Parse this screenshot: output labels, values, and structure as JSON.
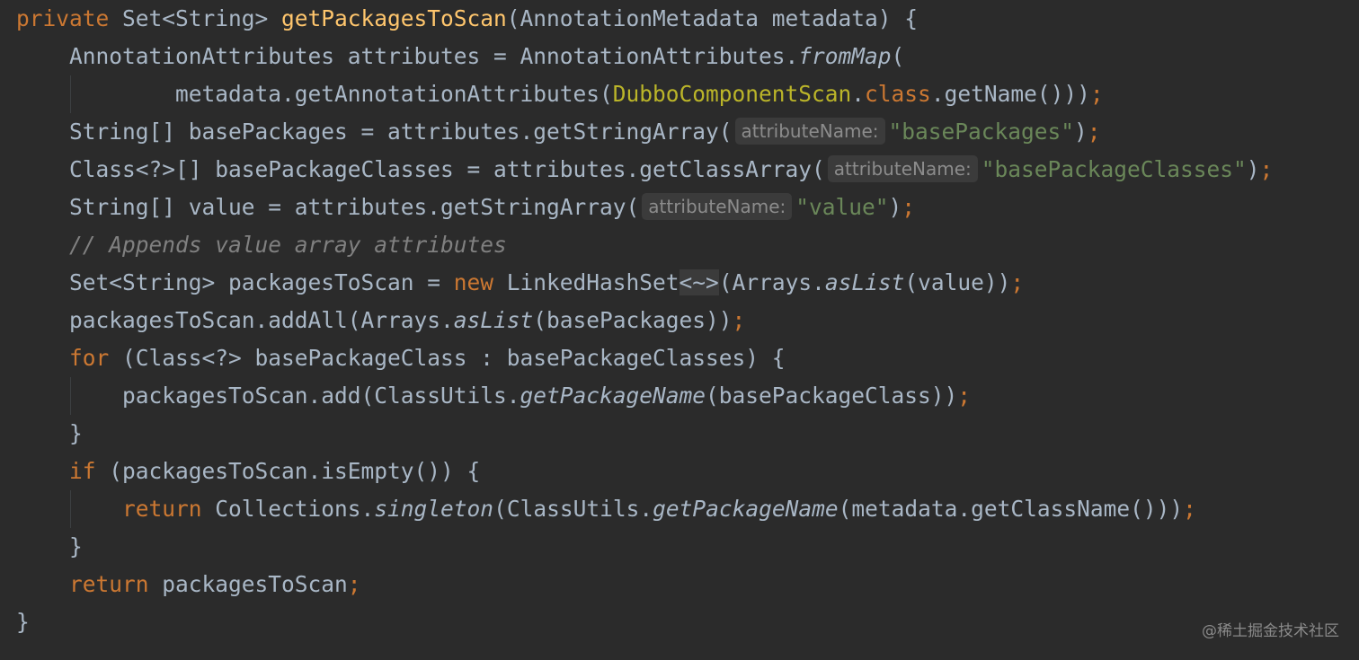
{
  "lines": [
    [
      {
        "t": "private ",
        "c": "kw"
      },
      {
        "t": "Set<String> ",
        "c": ""
      },
      {
        "t": "getPackagesToScan",
        "c": "fn"
      },
      {
        "t": "(AnnotationMetadata metadata) {",
        "c": ""
      }
    ],
    [
      {
        "t": "    AnnotationAttributes attributes = AnnotationAttributes.",
        "c": ""
      },
      {
        "t": "fromMap",
        "c": "ital"
      },
      {
        "t": "(",
        "c": ""
      }
    ],
    [
      {
        "t": "            metadata.getAnnotationAttributes(",
        "c": ""
      },
      {
        "t": "DubboComponentScan",
        "c": "ann"
      },
      {
        "t": ".",
        "c": ""
      },
      {
        "t": "class",
        "c": "kw"
      },
      {
        "t": ".getName()))",
        "c": ""
      },
      {
        "t": ";",
        "c": "punc"
      }
    ],
    [
      {
        "t": "    String[] basePackages = attributes.getStringArray(",
        "c": ""
      },
      {
        "t": "attributeName:",
        "c": "hint"
      },
      {
        "t": "\"basePackages\"",
        "c": "str"
      },
      {
        "t": ")",
        "c": ""
      },
      {
        "t": ";",
        "c": "punc"
      }
    ],
    [
      {
        "t": "    Class<?>[] basePackageClasses = attributes.getClassArray(",
        "c": ""
      },
      {
        "t": "attributeName:",
        "c": "hint"
      },
      {
        "t": "\"basePackageClasses\"",
        "c": "str"
      },
      {
        "t": ")",
        "c": ""
      },
      {
        "t": ";",
        "c": "punc"
      }
    ],
    [
      {
        "t": "    String[] value = attributes.getStringArray(",
        "c": ""
      },
      {
        "t": "attributeName:",
        "c": "hint"
      },
      {
        "t": "\"value\"",
        "c": "str"
      },
      {
        "t": ")",
        "c": ""
      },
      {
        "t": ";",
        "c": "punc"
      }
    ],
    [
      {
        "t": "    // Appends value array attributes",
        "c": "cmt ital"
      }
    ],
    [
      {
        "t": "    Set<String> packagesToScan = ",
        "c": ""
      },
      {
        "t": "new ",
        "c": "kw"
      },
      {
        "t": "LinkedHashSet",
        "c": ""
      },
      {
        "t": "<~>",
        "c": "diamond"
      },
      {
        "t": "(Arrays.",
        "c": ""
      },
      {
        "t": "asList",
        "c": "ital"
      },
      {
        "t": "(value))",
        "c": ""
      },
      {
        "t": ";",
        "c": "punc"
      }
    ],
    [
      {
        "t": "    packagesToScan.addAll(Arrays.",
        "c": ""
      },
      {
        "t": "asList",
        "c": "ital"
      },
      {
        "t": "(basePackages))",
        "c": ""
      },
      {
        "t": ";",
        "c": "punc"
      }
    ],
    [
      {
        "t": "    ",
        "c": ""
      },
      {
        "t": "for ",
        "c": "kw"
      },
      {
        "t": "(Class<?> basePackageClass : basePackageClasses) {",
        "c": ""
      }
    ],
    [
      {
        "t": "        packagesToScan.add(ClassUtils.",
        "c": ""
      },
      {
        "t": "getPackageName",
        "c": "ital"
      },
      {
        "t": "(basePackageClass))",
        "c": ""
      },
      {
        "t": ";",
        "c": "punc"
      }
    ],
    [
      {
        "t": "    }",
        "c": ""
      }
    ],
    [
      {
        "t": "    ",
        "c": ""
      },
      {
        "t": "if ",
        "c": "kw"
      },
      {
        "t": "(packagesToScan.isEmpty()) {",
        "c": ""
      }
    ],
    [
      {
        "t": "        ",
        "c": ""
      },
      {
        "t": "return ",
        "c": "kw"
      },
      {
        "t": "Collections.",
        "c": ""
      },
      {
        "t": "singleton",
        "c": "ital"
      },
      {
        "t": "(ClassUtils.",
        "c": ""
      },
      {
        "t": "getPackageName",
        "c": "ital"
      },
      {
        "t": "(metadata.getClassName()))",
        "c": ""
      },
      {
        "t": ";",
        "c": "punc"
      }
    ],
    [
      {
        "t": "    }",
        "c": ""
      }
    ],
    [
      {
        "t": "    ",
        "c": ""
      },
      {
        "t": "return ",
        "c": "kw"
      },
      {
        "t": "packagesToScan",
        "c": ""
      },
      {
        "t": ";",
        "c": "punc"
      }
    ],
    [
      {
        "t": "}",
        "c": ""
      }
    ]
  ],
  "watermark": "@稀土掘金技术社区",
  "colors": {
    "background": "#2b2b2b",
    "text": "#a9b7c6",
    "keyword": "#cc7832",
    "method_declaration": "#ffc66d",
    "string": "#6a8759",
    "comment": "#808080",
    "annotation_class": "#bbb529",
    "inlay_hint": "#8c8c8c"
  }
}
